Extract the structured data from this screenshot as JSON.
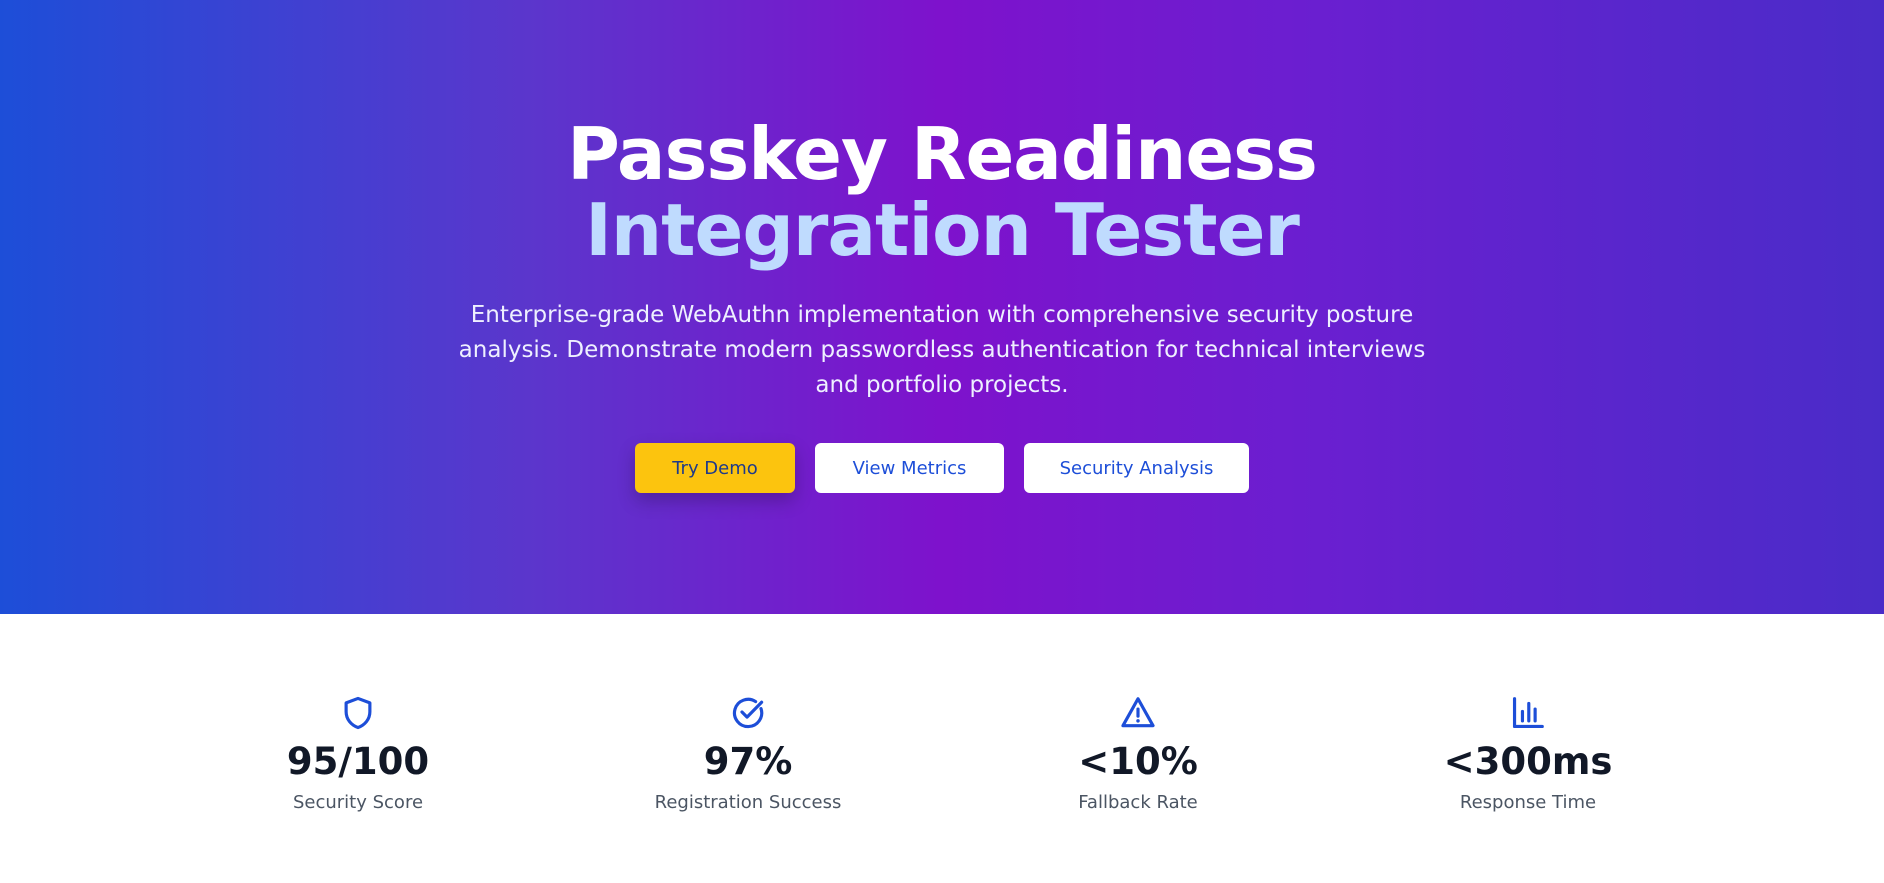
{
  "hero": {
    "title_line1": "Passkey Readiness",
    "title_line2": "Integration Tester",
    "subtitle": "Enterprise-grade WebAuthn implementation with comprehensive security posture analysis. Demonstrate modern passwordless authentication for technical interviews and portfolio projects.",
    "buttons": {
      "try_demo": "Try Demo",
      "view_metrics": "View Metrics",
      "security_analysis": "Security Analysis"
    }
  },
  "stats": [
    {
      "icon": "shield-icon",
      "value": "95/100",
      "label": "Security Score"
    },
    {
      "icon": "check-circle-icon",
      "value": "97%",
      "label": "Registration Success"
    },
    {
      "icon": "warning-triangle-icon",
      "value": "<10%",
      "label": "Fallback Rate"
    },
    {
      "icon": "bar-chart-icon",
      "value": "<300ms",
      "label": "Response Time"
    }
  ],
  "colors": {
    "hero_gradient": [
      "#1d4ed8",
      "#7e12cc",
      "#4a2cc8"
    ],
    "title_accent": "#bfdbfe",
    "primary_button": "#fcc40e",
    "icon_blue": "#1d4ed8",
    "stat_value": "#111827",
    "stat_label": "#4b5563"
  }
}
